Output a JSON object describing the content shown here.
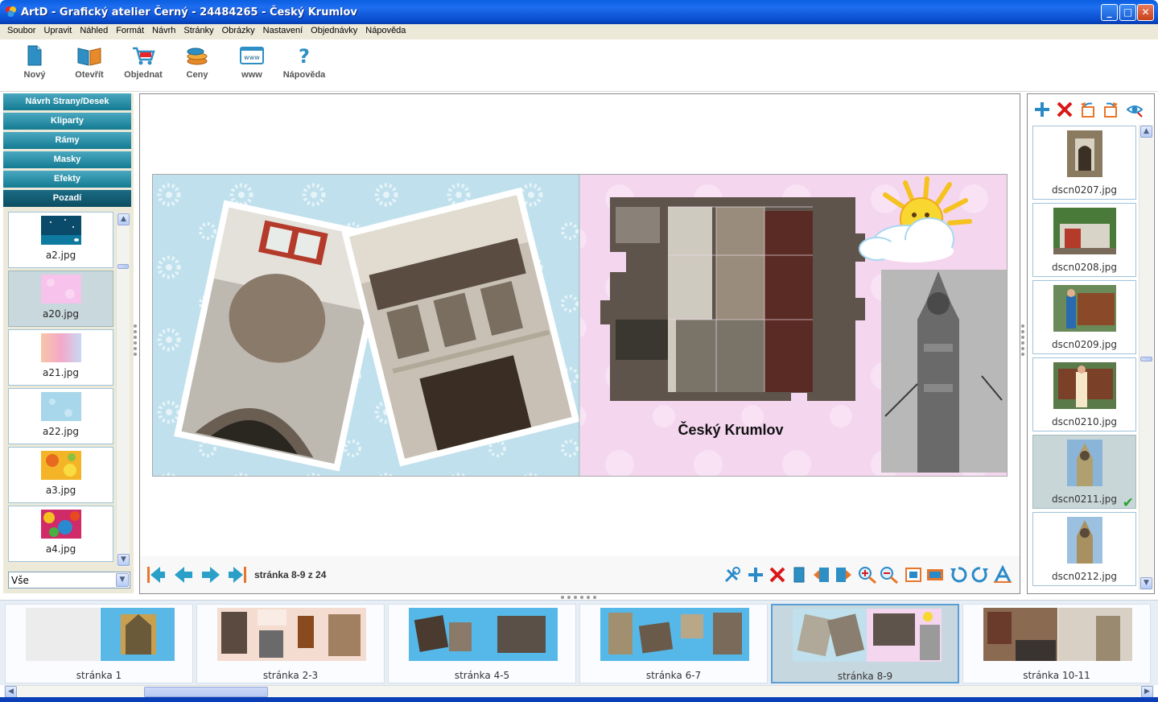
{
  "window": {
    "title": "ArtD - Grafický atelier Černý - 24484265 - Český Krumlov",
    "minimize": "_",
    "maximize": "□",
    "close": "✕"
  },
  "menu": [
    "Soubor",
    "Upravit",
    "Náhled",
    "Formát",
    "Návrh",
    "Stránky",
    "Obrázky",
    "Nastavení",
    "Objednávky",
    "Nápověda"
  ],
  "toolbar": {
    "new": "Nový",
    "open": "Otevřít",
    "order": "Objednat",
    "prices": "Ceny",
    "www": "www",
    "help": "Nápověda",
    "www_icon_text": "www",
    "help_icon_text": "?"
  },
  "left_panel": {
    "sections": [
      "Návrh Strany/Desek",
      "Kliparty",
      "Rámy",
      "Masky",
      "Efekty",
      "Pozadí"
    ],
    "active_section": "Pozadí",
    "backgrounds": [
      "a2.jpg",
      "a20.jpg",
      "a21.jpg",
      "a22.jpg",
      "a3.jpg",
      "a4.jpg"
    ],
    "selected_background": "a20.jpg",
    "filter_value": "Vše"
  },
  "editor": {
    "page_caption": "Český Krumlov",
    "page_info": "stránka 8-9 z 24"
  },
  "right_panel": {
    "photos": [
      "dscn0207.jpg",
      "dscn0208.jpg",
      "dscn0209.jpg",
      "dscn0210.jpg",
      "dscn0211.jpg",
      "dscn0212.jpg"
    ],
    "selected_photo": "dscn0211.jpg",
    "used_mark": "✔"
  },
  "pages_strip": [
    "stránka 1",
    "stránka 2-3",
    "stránka 4-5",
    "stránka 6-7",
    "stránka 8-9",
    "stránka 10-11"
  ],
  "selected_page": "stránka 8-9",
  "colors": {
    "accordion": "#137b92",
    "accordion_active": "#0c4d62",
    "nav_arrows": "#2aa0c8",
    "delete_red": "#d81818",
    "add_blue": "#2a8ac8",
    "left_page_bg": "#bfe0ec",
    "right_page_bg": "#f4d6ef"
  }
}
